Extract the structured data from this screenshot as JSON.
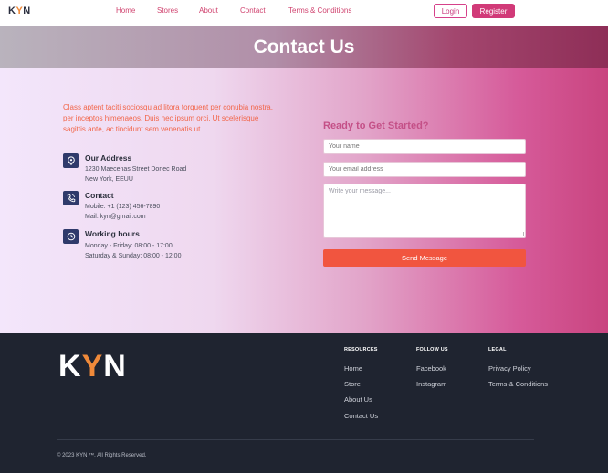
{
  "nav": {
    "logo_k": "K",
    "logo_y": "Y",
    "logo_n": "N",
    "links": [
      "Home",
      "Stores",
      "About",
      "Contact",
      "Terms & Conditions"
    ],
    "login": "Login",
    "register": "Register"
  },
  "hero": {
    "title": "Contact Us"
  },
  "contact": {
    "intro": "Class aptent taciti sociosqu ad litora torquent per conubia nostra, per inceptos himenaeos. Duis nec ipsum orci. Ut scelerisque sagittis ante, ac tincidunt sem venenatis ut.",
    "address": {
      "title": "Our Address",
      "lines": [
        "1230 Maecenas Street Donec Road",
        "New York, EEUU"
      ]
    },
    "phone": {
      "title": "Contact",
      "lines": [
        "Mobile: +1 (123) 456-7890",
        "Mail: kyn@gmail.com"
      ]
    },
    "hours": {
      "title": "Working hours",
      "lines": [
        "Monday - Friday: 08:00 - 17:00",
        "Saturday & Sunday: 08:00 - 12:00"
      ]
    }
  },
  "form": {
    "title": "Ready to Get Started?",
    "name_placeholder": "Your name",
    "email_placeholder": "Your email address",
    "message_placeholder": "Write your message...",
    "send": "Send Message"
  },
  "footer": {
    "logo_k": "K",
    "logo_y": "Y",
    "logo_n": "N",
    "resources": {
      "title": "RESOURCES",
      "links": [
        "Home",
        "Store",
        "About Us",
        "Contact Us"
      ]
    },
    "follow": {
      "title": "FOLLOW US",
      "links": [
        "Facebook",
        "Instagram"
      ]
    },
    "legal": {
      "title": "LEGAL",
      "links": [
        "Privacy Policy",
        "Terms & Conditions"
      ]
    },
    "copyright": "© 2023 KYN ™. All Rights Reserved."
  },
  "colors": {
    "accent": "#d13a78",
    "orange": "#f1553f",
    "navy": "#2f3a6b",
    "footer_bg": "#1f2430"
  }
}
